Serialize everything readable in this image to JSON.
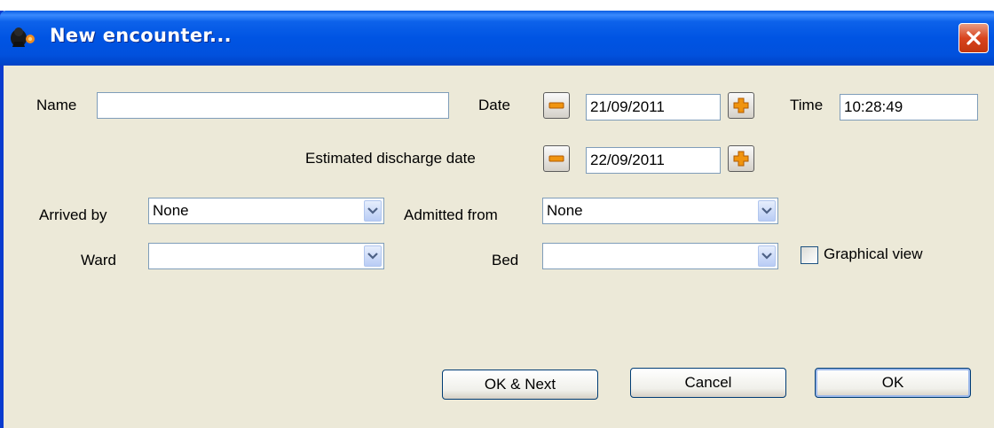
{
  "window": {
    "title": "New encounter..."
  },
  "form": {
    "name_label": "Name",
    "name_value": "",
    "date_label": "Date",
    "date_value": "21/09/2011",
    "time_label": "Time",
    "time_value": "10:28:49",
    "discharge_label": "Estimated discharge date",
    "discharge_value": "22/09/2011",
    "arrived_by_label": "Arrived by",
    "arrived_by_value": "None",
    "admitted_from_label": "Admitted from",
    "admitted_from_value": "None",
    "ward_label": "Ward",
    "ward_value": "",
    "bed_label": "Bed",
    "bed_value": "",
    "graphical_view_label": "Graphical view",
    "graphical_view_checked": false
  },
  "buttons": {
    "ok_next": "OK & Next",
    "cancel": "Cancel",
    "ok": "OK"
  },
  "icons": {
    "app": "app-icon",
    "close": "close-icon",
    "minus": "minus-icon",
    "plus": "plus-icon",
    "dropdown": "chevron-down-icon"
  },
  "colors": {
    "titlebar": "#0054E3",
    "dialog_bg": "#ECE9D8",
    "close_button": "#D9441E",
    "spin_accent": "#F0940F",
    "field_border": "#7F9DB9"
  }
}
